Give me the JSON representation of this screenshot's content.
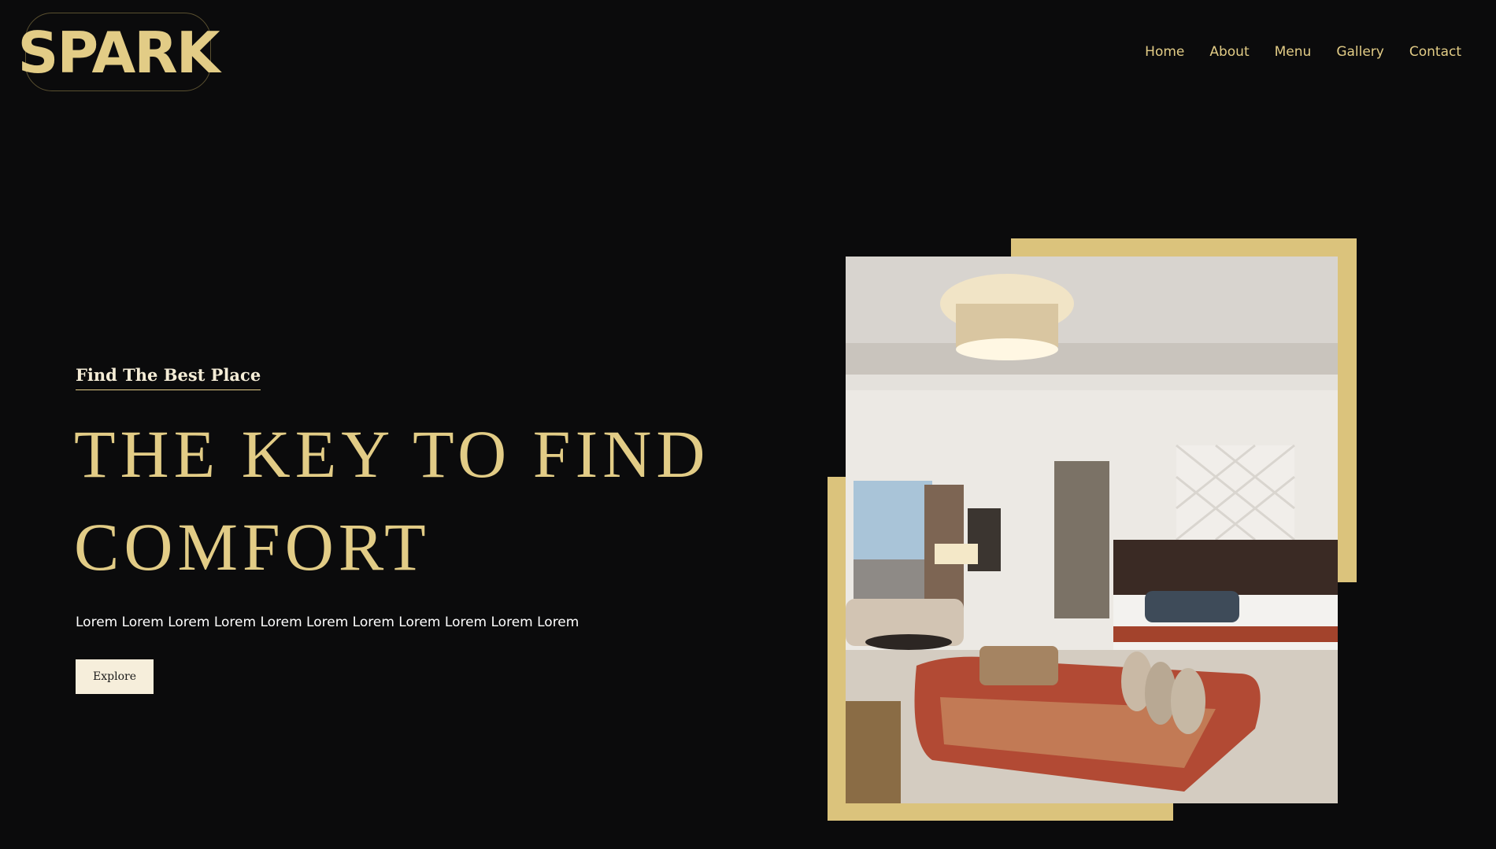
{
  "brand": {
    "logo_text": "SPARK",
    "accent_color": "#e2cc86",
    "background_color": "#0b0b0c"
  },
  "nav": {
    "items": [
      {
        "label": "Home"
      },
      {
        "label": "About"
      },
      {
        "label": "Menu"
      },
      {
        "label": "Gallery"
      },
      {
        "label": "Contact"
      }
    ]
  },
  "hero": {
    "eyebrow": "Find The Best Place",
    "title_line1": "THE KEY TO FIND",
    "title_line2": "COMFORT",
    "description": "Lorem Lorem Lorem Lorem Lorem Lorem Lorem Lorem Lorem Lorem Lorem",
    "cta_label": "Explore",
    "image_subject": "hotel bedroom interior with chandelier, bed, and red chaise sofa"
  }
}
